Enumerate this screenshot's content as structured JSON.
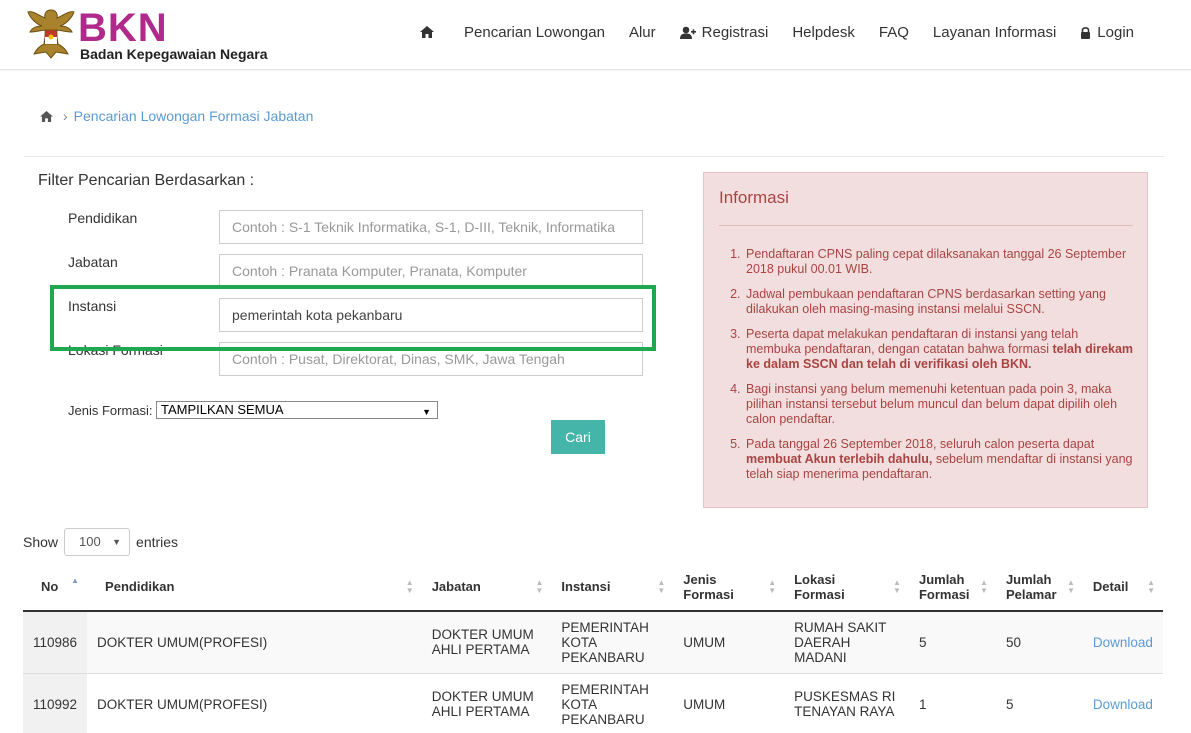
{
  "brand": {
    "title": "BKN",
    "subtitle": "Badan Kepegawaian Negara"
  },
  "nav": {
    "items": [
      {
        "label": "Pencarian Lowongan"
      },
      {
        "label": "Alur"
      },
      {
        "label": "Registrasi"
      },
      {
        "label": "Helpdesk"
      },
      {
        "label": "FAQ"
      },
      {
        "label": "Layanan Informasi"
      },
      {
        "label": "Login"
      }
    ]
  },
  "breadcrumb": {
    "current": "Pencarian Lowongan Formasi Jabatan"
  },
  "filter": {
    "title": "Filter Pencarian Berdasarkan :",
    "pendidikan": {
      "label": "Pendidikan",
      "placeholder": "Contoh : S-1 Teknik Informatika, S-1, D-III, Teknik, Informatika",
      "value": ""
    },
    "jabatan": {
      "label": "Jabatan",
      "placeholder": "Contoh : Pranata Komputer, Pranata, Komputer",
      "value": ""
    },
    "instansi": {
      "label": "Instansi",
      "placeholder": "",
      "value": "pemerintah kota pekanbaru"
    },
    "lokasi": {
      "label": "Lokasi Formasi",
      "placeholder": "Contoh : Pusat, Direktorat, Dinas, SMK, Jawa Tengah",
      "value": ""
    },
    "jenis_label": "Jenis Formasi:",
    "jenis_value": "TAMPILKAN SEMUA",
    "search_button": "Cari"
  },
  "info": {
    "title": "Informasi",
    "items": [
      {
        "text": "Pendaftaran CPNS paling cepat dilaksanakan tanggal 26 September 2018 pukul 00.01 WIB."
      },
      {
        "text": "Jadwal pembukaan pendaftaran CPNS berdasarkan setting yang dilakukan oleh masing-masing instansi melalui SSCN."
      },
      {
        "text": "Peserta dapat melakukan pendaftaran di instansi yang telah membuka pendaftaran, dengan catatan bahwa formasi ",
        "bold": "telah direkam ke dalam SSCN dan telah di verifikasi oleh BKN.",
        "after": ""
      },
      {
        "text": "Bagi instansi yang belum memenuhi ketentuan pada poin 3, maka pilihan instansi tersebut belum muncul dan belum dapat dipilih oleh calon pendaftar."
      },
      {
        "text": "Pada tanggal 26 September 2018, seluruh calon peserta dapat ",
        "bold": "membuat Akun terlebih dahulu,",
        "after": " sebelum mendaftar di instansi yang telah siap menerima pendaftaran."
      }
    ]
  },
  "table_controls": {
    "show_label": "Show",
    "show_value": "100",
    "entries_label": "entries"
  },
  "table": {
    "headers": [
      "No",
      "Pendidikan",
      "Jabatan",
      "Instansi",
      "Jenis Formasi",
      "Lokasi Formasi",
      "Jumlah Formasi",
      "Jumlah Pelamar",
      "Detail"
    ],
    "rows": [
      {
        "no": "110986",
        "pendidikan": "DOKTER UMUM(PROFESI)",
        "jabatan": "DOKTER UMUM AHLI PERTAMA",
        "instansi": "PEMERINTAH KOTA PEKANBARU",
        "jenis": "UMUM",
        "lokasi": "RUMAH SAKIT DAERAH MADANI",
        "jumlah_formasi": "5",
        "jumlah_pelamar": "50",
        "detail": "Download"
      },
      {
        "no": "110992",
        "pendidikan": "DOKTER UMUM(PROFESI)",
        "jabatan": "DOKTER UMUM AHLI PERTAMA",
        "instansi": "PEMERINTAH KOTA PEKANBARU",
        "jenis": "UMUM",
        "lokasi": "PUSKESMAS RI TENAYAN RAYA",
        "jumlah_formasi": "1",
        "jumlah_pelamar": "5",
        "detail": "Download"
      }
    ]
  }
}
